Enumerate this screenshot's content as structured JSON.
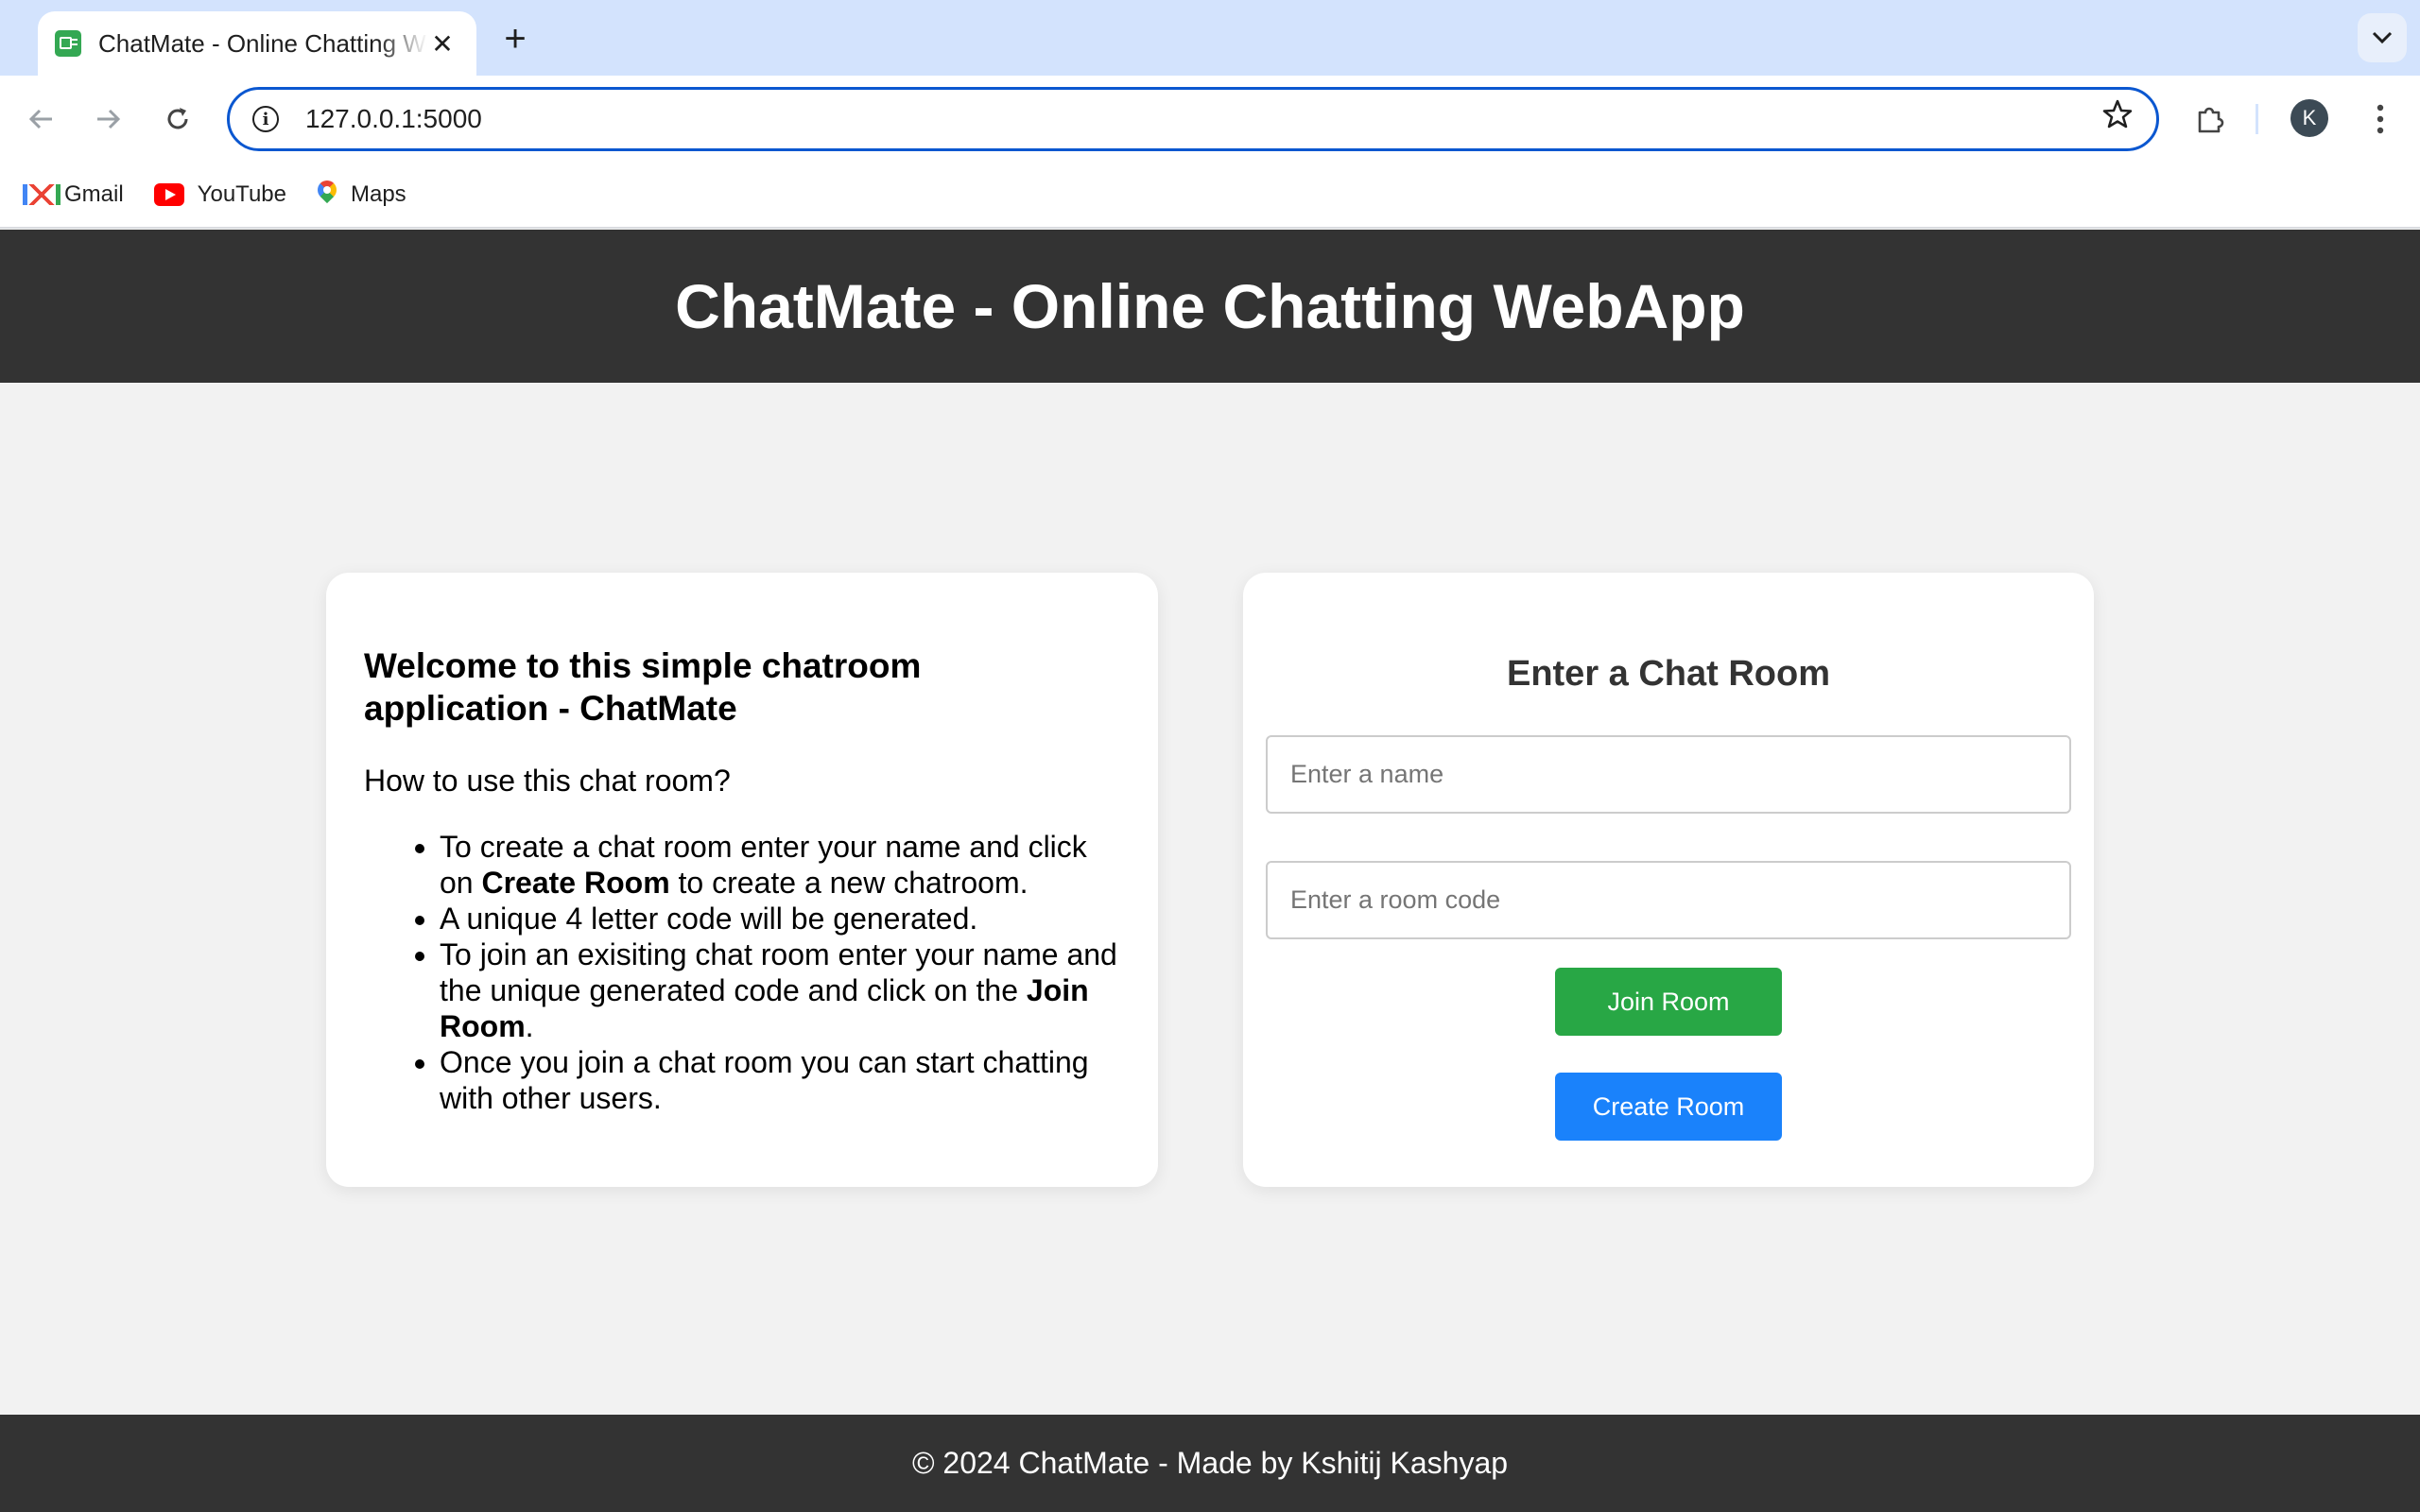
{
  "browser": {
    "tab_title": "ChatMate - Online Chatting WebApp",
    "tab_close_glyph": "✕",
    "new_tab_glyph": "+",
    "tab_search_glyph": "⌄",
    "url": "127.0.0.1:5000",
    "avatar_letter": "K",
    "bookmarks": [
      {
        "label": "Gmail",
        "icon": "gmail-icon"
      },
      {
        "label": "YouTube",
        "icon": "youtube-icon"
      },
      {
        "label": "Maps",
        "icon": "maps-icon"
      }
    ],
    "accent_color": "#0b57d0",
    "tabbar_color": "#d3e3fd"
  },
  "header": {
    "title": "ChatMate - Online Chatting WebApp",
    "bg_color": "#333333"
  },
  "info_card": {
    "heading": "Welcome to this simple chatroom application - ChatMate",
    "subheading": "How to use this chat room?",
    "items": [
      {
        "before": "To create a chat room enter your name and click on ",
        "bold": "Create Room",
        "after": " to create a new chatroom."
      },
      {
        "before": "A unique 4 letter code will be generated.",
        "bold": "",
        "after": ""
      },
      {
        "before": "To join an exisiting chat room enter your name and the unique generated code and click on the ",
        "bold": "Join Room",
        "after": "."
      },
      {
        "before": "Once you join a chat room you can start chatting with other users.",
        "bold": "",
        "after": ""
      }
    ]
  },
  "form_card": {
    "title": "Enter a Chat Room",
    "name_placeholder": "Enter a name",
    "name_value": "",
    "code_placeholder": "Enter a room code",
    "code_value": "",
    "join_label": "Join Room",
    "create_label": "Create Room",
    "join_color": "#28a745",
    "create_color": "#1a82fb"
  },
  "footer": {
    "text": "© 2024 ChatMate - Made by Kshitij Kashyap"
  }
}
